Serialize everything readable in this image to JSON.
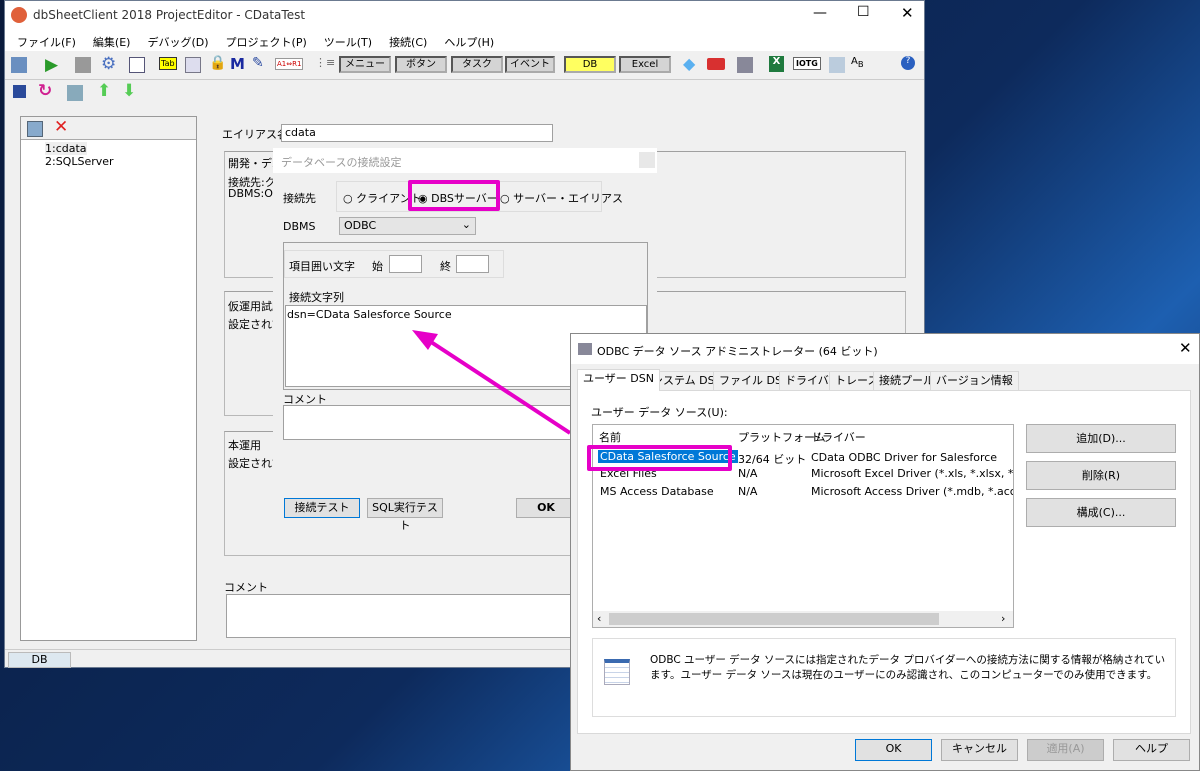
{
  "main_window": {
    "title": "dbSheetClient 2018 ProjectEditor - CDataTest",
    "menu": [
      "ファイル(F)",
      "編集(E)",
      "デバッグ(D)",
      "プロジェクト(P)",
      "ツール(T)",
      "接続(C)",
      "ヘルプ(H)"
    ],
    "toolbar_buttons": [
      "メニュー",
      "ボタン",
      "タスク",
      "イベント",
      "DB",
      "Excel"
    ],
    "toolbar_icon_labels": {
      "iotg": "IOTG",
      "tab": "Tab",
      "m": "M",
      "a1r1": "A1⇔R1"
    },
    "list_items": [
      "1:cdata",
      "2:SQLServer"
    ],
    "alias_label": "エイリアス名",
    "alias_value": "cdata",
    "groups": [
      {
        "title": "開発・デバ",
        "lines": [
          "接続先:ク",
          "DBMS:OD"
        ]
      },
      {
        "title": "仮運用試験",
        "lines": [
          "設定されて"
        ]
      },
      {
        "title": "本運用",
        "lines": [
          "設定されて"
        ]
      }
    ],
    "comment_label": "コメント",
    "status_tab": "DB"
  },
  "connection_dialog": {
    "title": "データベースの接続設定",
    "target_label": "接続先",
    "radios": [
      {
        "label": "クライアント",
        "checked": false
      },
      {
        "label": "DBSサーバー",
        "checked": true
      },
      {
        "label": "サーバー・エイリアス",
        "checked": false
      }
    ],
    "dbms_label": "DBMS",
    "dbms_value": "ODBC",
    "quote_label": "項目囲い文字",
    "start_label": "始",
    "end_label": "終",
    "conn_string_label": "接続文字列",
    "conn_string_value": "dsn=CData Salesforce Source",
    "comment_label": "コメント",
    "buttons": {
      "test": "接続テスト",
      "sql_test": "SQL実行テスト",
      "ok": "OK"
    }
  },
  "odbc_dialog": {
    "title": "ODBC データ ソース アドミニストレーター (64 ビット)",
    "tabs": [
      "ユーザー DSN",
      "システム DSN",
      "ファイル DSN",
      "ドライバー",
      "トレース",
      "接続プール",
      "バージョン情報"
    ],
    "list_label": "ユーザー データ ソース(U):",
    "columns": [
      "名前",
      "プラットフォーム",
      "ドライバー"
    ],
    "rows": [
      [
        "CData Salesforce Source",
        "32/64 ビット",
        "CData ODBC Driver for Salesforce"
      ],
      [
        "Excel Files",
        "N/A",
        "Microsoft Excel Driver (*.xls, *.xlsx, *.xlsm, *.xlsb)"
      ],
      [
        "MS Access Database",
        "N/A",
        "Microsoft Access Driver (*.mdb, *.accdb)"
      ]
    ],
    "side_buttons": [
      "追加(D)...",
      "削除(R)",
      "構成(C)..."
    ],
    "info": "ODBC ユーザー データ ソースには指定されたデータ プロバイダーへの接続方法に関する情報が格納されています。ユーザー データ ソースは現在のユーザーにのみ認識され、このコンピューターでのみ使用できます。",
    "bottom_buttons": [
      "OK",
      "キャンセル",
      "適用(A)",
      "ヘルプ"
    ]
  },
  "colors": {
    "highlight": "#e600c8",
    "selection": "#0078d7"
  }
}
